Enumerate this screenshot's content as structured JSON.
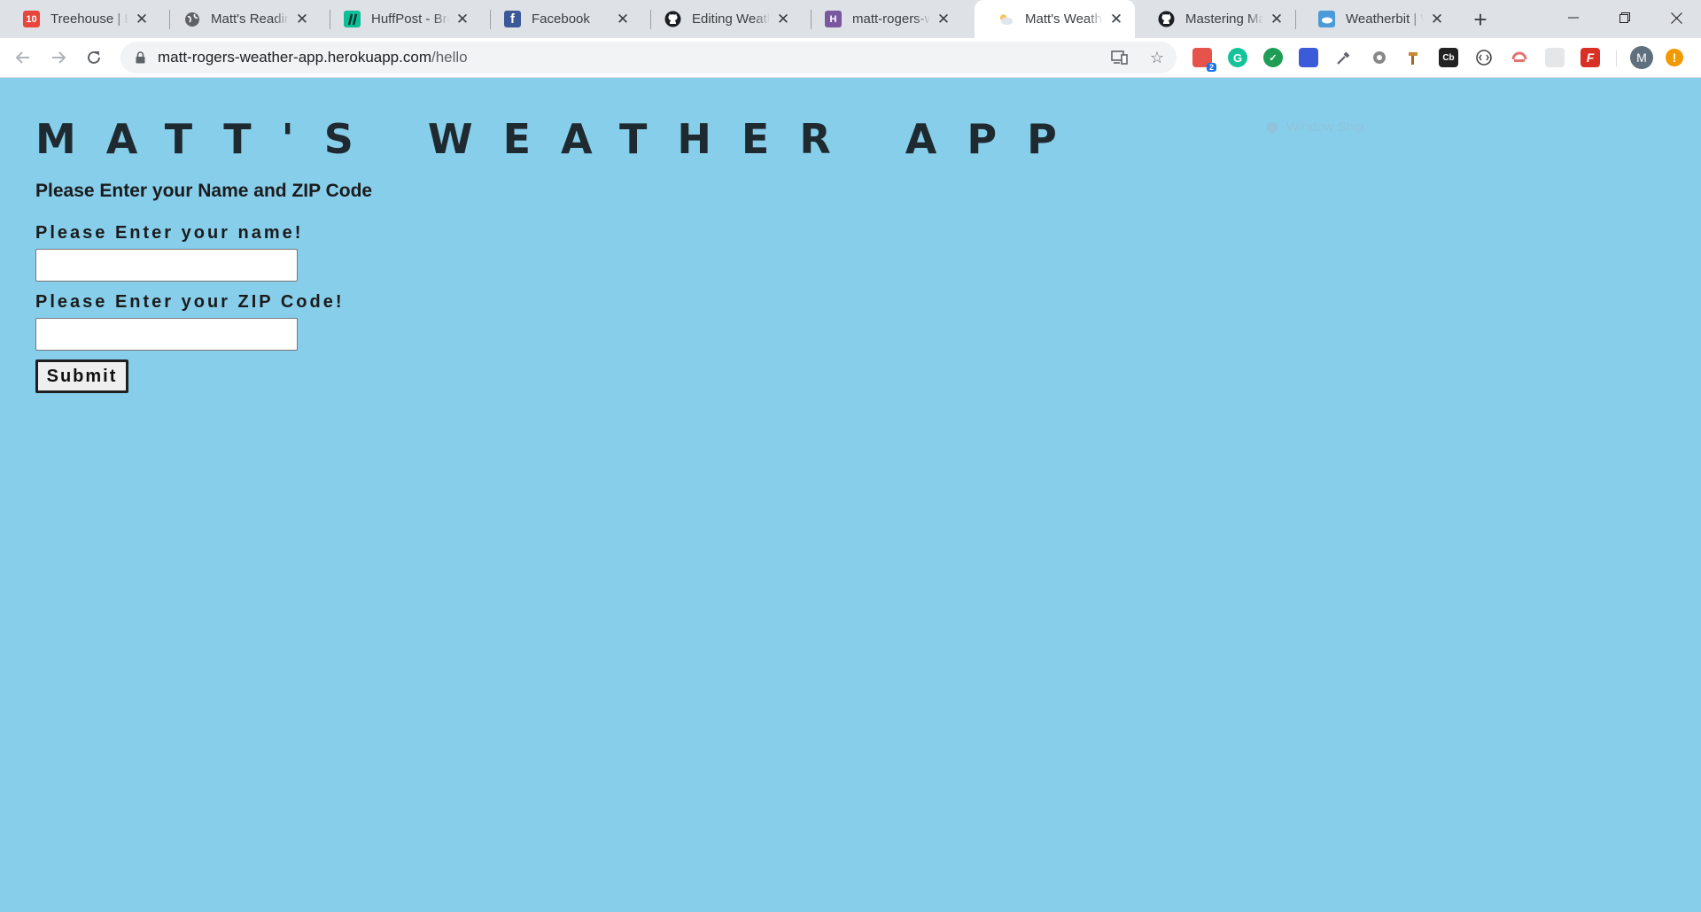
{
  "browser": {
    "tabs": [
      {
        "title": "Treehouse | Full",
        "icon": "treehouse-icon",
        "badge": "10",
        "active": false
      },
      {
        "title": "Matt's Reading",
        "icon": "globe-icon",
        "active": false
      },
      {
        "title": "HuffPost - Brea",
        "icon": "huffpost-icon",
        "active": false
      },
      {
        "title": "Facebook",
        "icon": "facebook-icon",
        "active": false
      },
      {
        "title": "Editing Weathe",
        "icon": "github-icon",
        "active": false
      },
      {
        "title": "matt-rogers-w",
        "icon": "heroku-icon",
        "active": false
      },
      {
        "title": "Matt's Weather",
        "icon": "weather-cloud-icon",
        "active": true
      },
      {
        "title": "Mastering Mar",
        "icon": "github-icon",
        "active": false
      },
      {
        "title": "Weatherbit | W",
        "icon": "weatherbit-icon",
        "active": false
      }
    ],
    "new_tab_symbol": "+",
    "address": {
      "host": "matt-rogers-weather-app.herokuapp.com",
      "path": "/hello"
    },
    "extension_badge": "2",
    "profile_initial": "M",
    "update_symbol": "!"
  },
  "page": {
    "title": "MATT'S WEATHER APP",
    "subtitle": "Please Enter your Name and ZIP Code",
    "name_label": "Please Enter your name!",
    "name_value": "",
    "zip_label": "Please Enter your ZIP Code!",
    "zip_value": "",
    "submit_label": "Submit",
    "overlay_text": "Window Snip"
  },
  "colors": {
    "page_background": "#87ceeb",
    "tabstrip": "#dee1e6",
    "title_text": "#1f2a30"
  }
}
